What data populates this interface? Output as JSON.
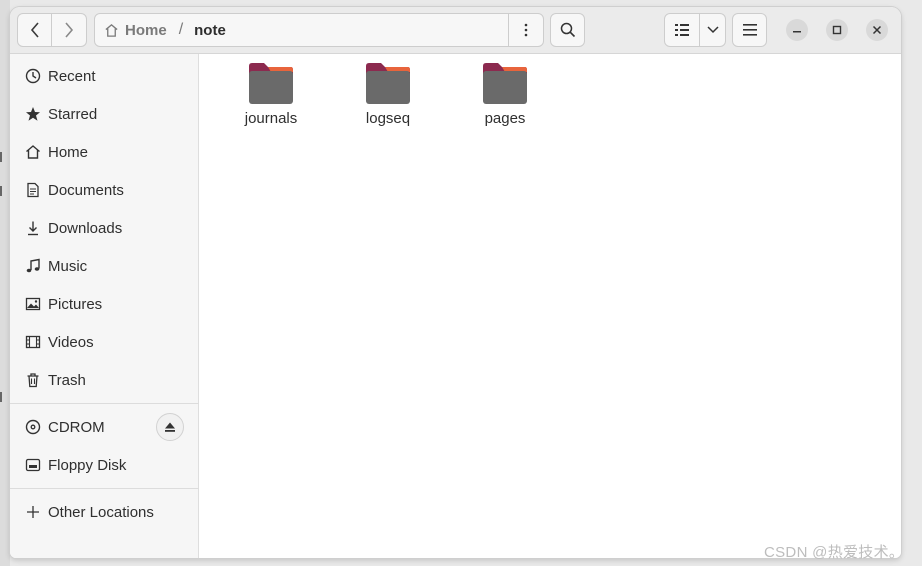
{
  "toolbar": {
    "back_icon": "chevron-left-icon",
    "forward_icon": "chevron-right-icon",
    "search_icon": "search-icon",
    "view_icon": "list-view-icon",
    "menu_icon": "hamburger-icon"
  },
  "pathbar": {
    "home_label": "Home",
    "separator": "/",
    "current_label": "note"
  },
  "sidebar": {
    "items": [
      {
        "label": "Recent",
        "icon": "clock-icon"
      },
      {
        "label": "Starred",
        "icon": "star-icon"
      },
      {
        "label": "Home",
        "icon": "home-icon"
      },
      {
        "label": "Documents",
        "icon": "document-icon"
      },
      {
        "label": "Downloads",
        "icon": "download-icon"
      },
      {
        "label": "Music",
        "icon": "music-icon"
      },
      {
        "label": "Pictures",
        "icon": "picture-icon"
      },
      {
        "label": "Videos",
        "icon": "video-icon"
      },
      {
        "label": "Trash",
        "icon": "trash-icon"
      }
    ],
    "devices": [
      {
        "label": "CDROM",
        "icon": "disc-icon"
      },
      {
        "label": "Floppy Disk",
        "icon": "drive-icon"
      }
    ],
    "other_locations": "Other Locations"
  },
  "files": [
    {
      "name": "journals",
      "type": "folder"
    },
    {
      "name": "logseq",
      "type": "folder"
    },
    {
      "name": "pages",
      "type": "folder"
    }
  ],
  "colors": {
    "folder_body": "#6a6a6a",
    "folder_tab": "#8c2a4f",
    "folder_accent": "#e8643c"
  },
  "watermark": "CSDN @热爱技术。"
}
